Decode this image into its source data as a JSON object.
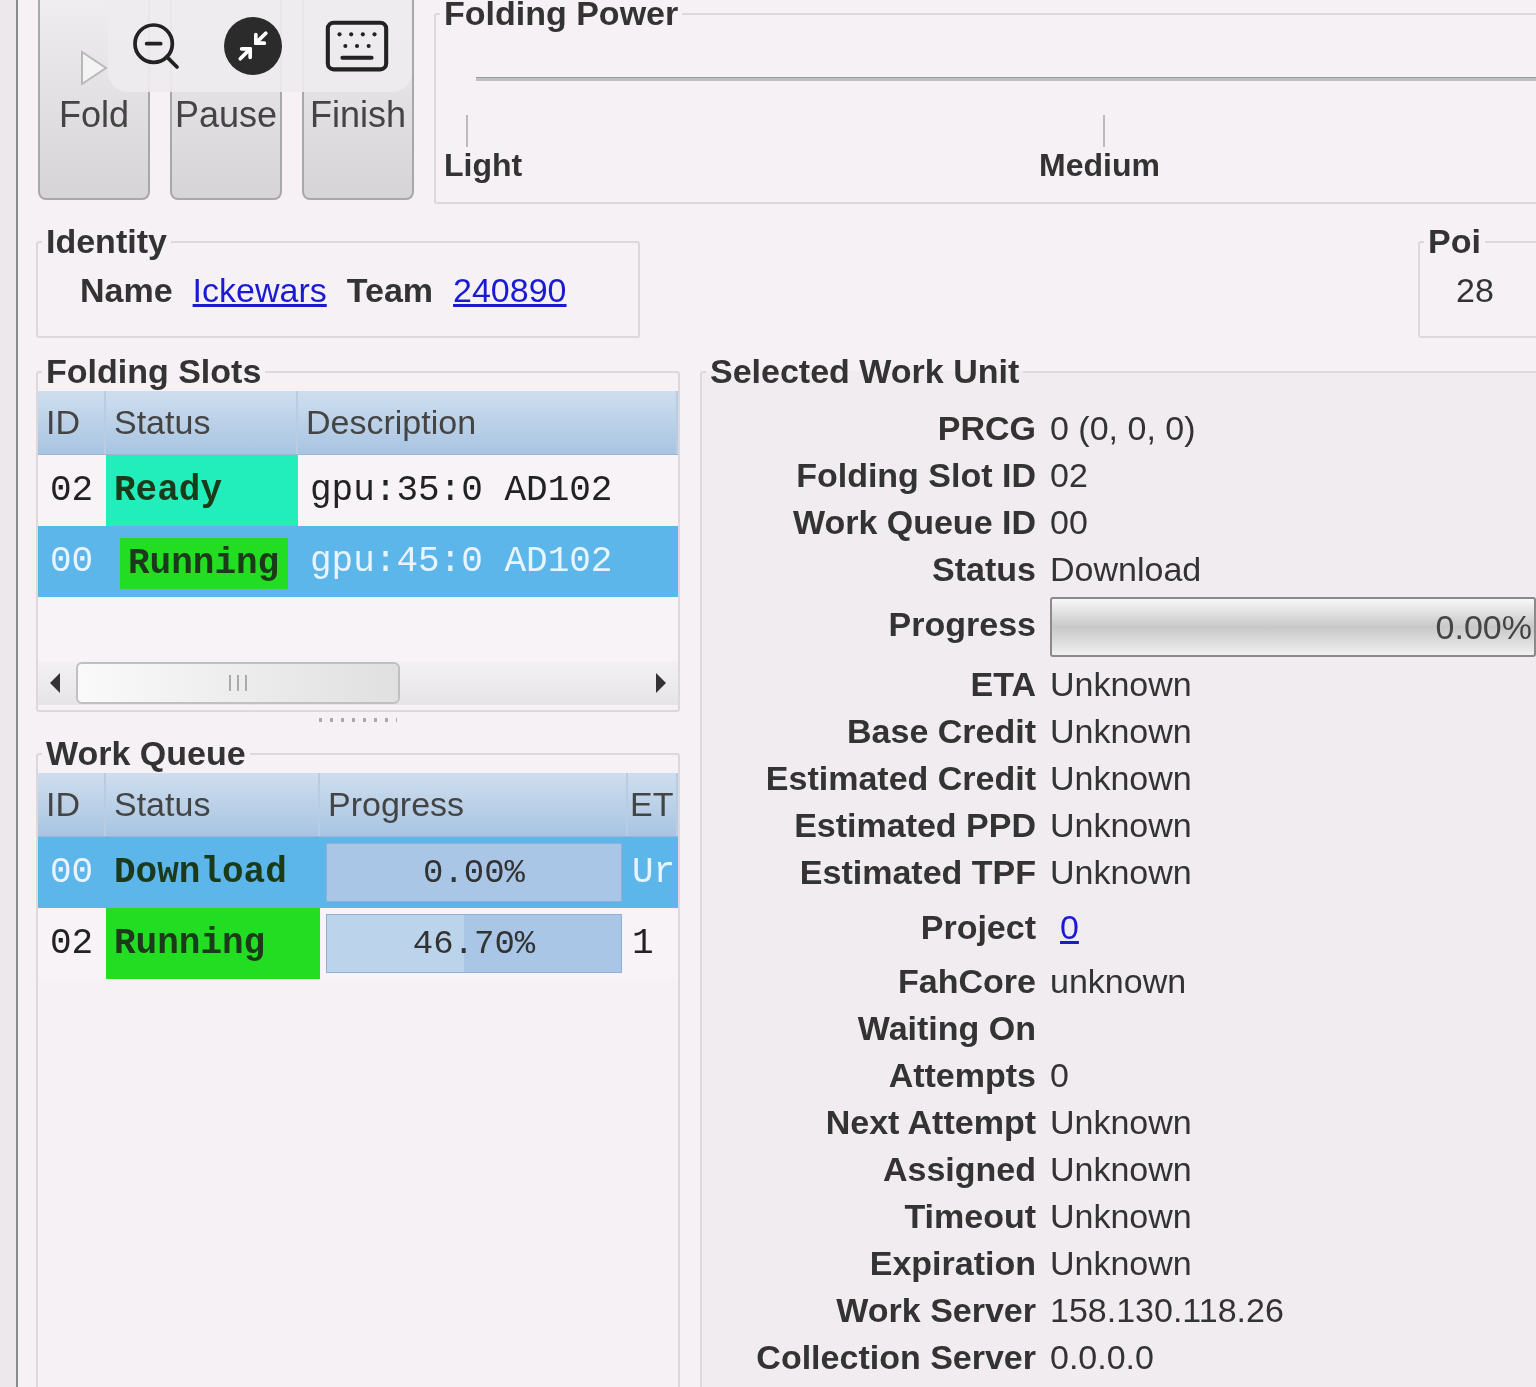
{
  "controls": [
    {
      "label": "Fold"
    },
    {
      "label": "Pause"
    },
    {
      "label": "Finish"
    }
  ],
  "folding_power": {
    "title": "Folding Power",
    "ticks": [
      "Light",
      "Medium"
    ]
  },
  "identity": {
    "title": "Identity",
    "name_label": "Name",
    "name": "Ickewars",
    "team_label": "Team",
    "team": "240890"
  },
  "points": {
    "title": "Poi",
    "value": "28"
  },
  "folding_slots": {
    "title": "Folding Slots",
    "columns": [
      "ID",
      "Status",
      "Description"
    ],
    "rows": [
      {
        "id": "02",
        "status": "Ready",
        "color": "#22eebb",
        "description": "gpu:35:0 AD102",
        "selected": false
      },
      {
        "id": "00",
        "status": "Running",
        "color": "#22dd22",
        "description": "gpu:45:0 AD102",
        "selected": true
      }
    ]
  },
  "work_queue": {
    "title": "Work Queue",
    "columns": [
      "ID",
      "Status",
      "Progress",
      "ET"
    ],
    "rows": [
      {
        "id": "00",
        "status": "Download",
        "progress": "0.00%",
        "level": 0,
        "eta": "Ur",
        "selected": true
      },
      {
        "id": "02",
        "status": "Running",
        "color": "#22dd22",
        "progress": "46.70%",
        "level": 0.467,
        "eta": "1",
        "selected": false
      }
    ]
  },
  "selected_work_unit": {
    "title": "Selected Work Unit",
    "fields": [
      {
        "label": "PRCG",
        "value": "0 (0, 0, 0)",
        "kind": "text"
      },
      {
        "label": "Folding Slot ID",
        "value": "02",
        "kind": "text"
      },
      {
        "label": "Work Queue ID",
        "value": "00",
        "kind": "text"
      },
      {
        "label": "Status",
        "value": "Download",
        "kind": "text"
      },
      {
        "label": "Progress",
        "value": "0.00%",
        "level": 0,
        "kind": "progress"
      },
      {
        "label": "ETA",
        "value": "Unknown",
        "kind": "text"
      },
      {
        "label": "Base Credit",
        "value": "Unknown",
        "kind": "text"
      },
      {
        "label": "Estimated Credit",
        "value": "Unknown",
        "kind": "text"
      },
      {
        "label": "Estimated PPD",
        "value": "Unknown",
        "kind": "text"
      },
      {
        "label": "Estimated TPF",
        "value": "Unknown",
        "kind": "text"
      },
      {
        "label": "Project",
        "value": "0",
        "kind": "link"
      },
      {
        "label": "FahCore",
        "value": "unknown",
        "kind": "text"
      },
      {
        "label": "Waiting On",
        "kind": "text"
      },
      {
        "label": "Attempts",
        "value": "0",
        "kind": "text"
      },
      {
        "label": "Next Attempt",
        "value": "Unknown",
        "kind": "text"
      },
      {
        "label": "Assigned",
        "value": "Unknown",
        "kind": "text"
      },
      {
        "label": "Timeout",
        "value": "Unknown",
        "kind": "text"
      },
      {
        "label": "Expiration",
        "value": "Unknown",
        "kind": "text"
      },
      {
        "label": "Work Server",
        "value": "158.130.118.26",
        "kind": "text"
      },
      {
        "label": "Collection Server",
        "value": "0.0.0.0",
        "kind": "text"
      }
    ]
  }
}
